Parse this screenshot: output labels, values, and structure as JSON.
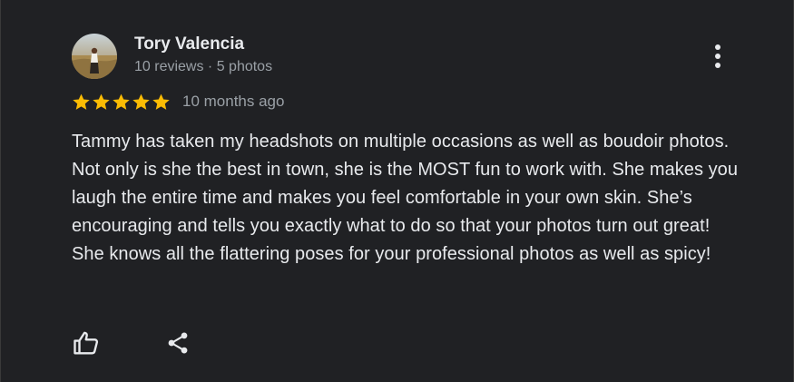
{
  "review": {
    "author": {
      "name": "Tory Valencia",
      "meta": "10 reviews · 5 photos",
      "avatar_icon": "user-photo-avatar"
    },
    "rating": 5,
    "rating_max": 5,
    "star_color": "#fbbc04",
    "date": "10 months ago",
    "text": "Tammy has taken my headshots on multiple occasions as well as boudoir photos. Not only is she the best in town, she is the MOST fun to work with. She makes you laugh the entire time and makes you feel comfortable in your own skin. She’s encouraging and tells you exactly what to do so that your photos turn out great! She knows all the flattering poses for your professional photos as well as spicy!",
    "more_icon": "more-vert-icon",
    "actions": {
      "like_icon": "thumb-up-icon",
      "share_icon": "share-icon"
    }
  },
  "colors": {
    "background": "#202124",
    "text_primary": "#e8eaed",
    "text_secondary": "#9aa0a6"
  }
}
